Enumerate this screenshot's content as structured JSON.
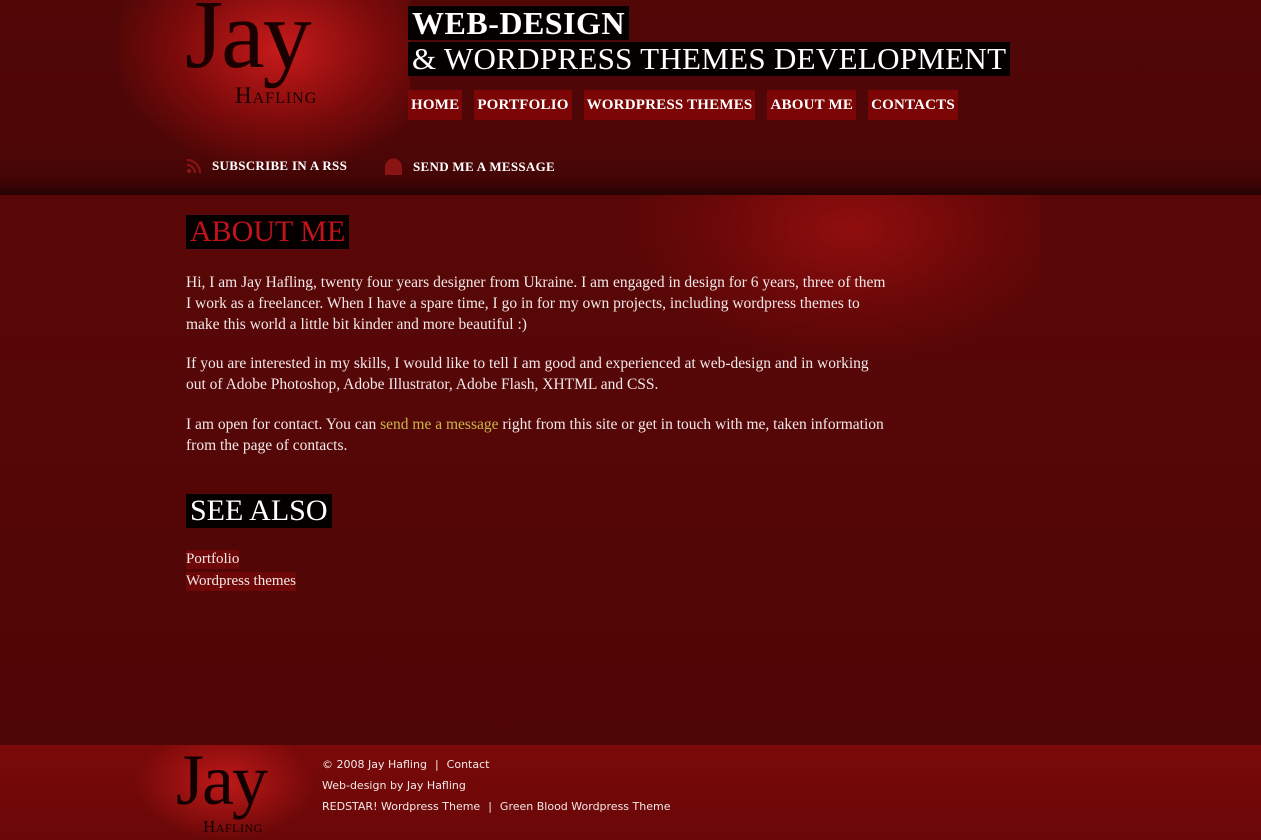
{
  "site": {
    "logo_word": "Jay",
    "logo_subword": "Hafling",
    "headline_1": "WEB-DESIGN",
    "headline_2": "& WORDPRESS THEMES DEVELOPMENT"
  },
  "nav": {
    "items": [
      {
        "label": "HOME"
      },
      {
        "label": "PORTFOLIO"
      },
      {
        "label": "WORDPRESS THEMES"
      },
      {
        "label": "ABOUT ME"
      },
      {
        "label": "CONTACTS"
      }
    ]
  },
  "subscribe": {
    "rss_label": "SUBSCRIBE IN A RSS",
    "message_label": "SEND ME A MESSAGE"
  },
  "content": {
    "about_title": "ABOUT ME",
    "paragraph_1": "Hi, I am Jay Hafling, twenty four years designer from Ukraine. I am engaged in design for 6 years, three of them I work as a freelancer. When I have a spare time, I go in for my own projects, including wordpress themes to make this world a little bit kinder and more beautiful :)",
    "paragraph_2": "If you are interested in my skills, I would like to tell I am good and experienced at web-design and in working out of Adobe Photoshop, Adobe Illustrator, Adobe Flash, XHTML and CSS.",
    "paragraph_3_before": "I am open for contact. You can ",
    "paragraph_3_link": "send me a message",
    "paragraph_3_after": " right from this site or get in touch with me, taken information from the page of contacts.",
    "see_also_title": "SEE ALSO",
    "see_also_links": [
      {
        "label": "Portfolio"
      },
      {
        "label": "Wordpress themes"
      }
    ]
  },
  "footer": {
    "copyright": "© 2008 Jay Hafling",
    "sep": "|",
    "contact_label": "Contact",
    "credit": "Web-design by Jay Hafling",
    "theme_1": "REDSTAR! Wordpress Theme",
    "theme_2": "Green Blood Wordpress Theme"
  },
  "colors": {
    "background": "#4a0505",
    "nav_bg": "#7c0606",
    "about_heading": "#c2121a",
    "link_accent": "#c9b84a"
  }
}
